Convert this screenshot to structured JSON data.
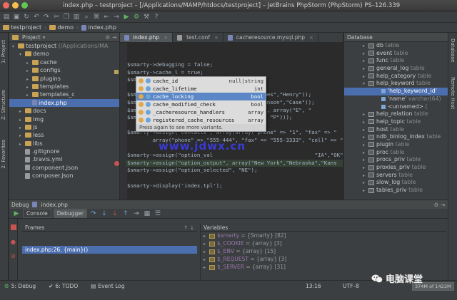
{
  "window": {
    "title": "index.php – testproject – [/Applications/MAMP/htdocs/testproject] – JetBrains PhpStorm (PhpStorm) PS–126.339"
  },
  "breadcrumb": [
    "testproject",
    "demo",
    "index.php"
  ],
  "left_strip": [
    "1: Project",
    "Z: Structure",
    "2: Favorites"
  ],
  "right_strip": [
    "Database",
    "Remote Host"
  ],
  "project": {
    "header": "Project",
    "tree": [
      {
        "label": "testproject",
        "suffix": " (/Applications/MA",
        "indent": 0,
        "kind": "folder",
        "open": true
      },
      {
        "label": "demo",
        "indent": 1,
        "kind": "folder",
        "open": true
      },
      {
        "label": "cache",
        "indent": 2,
        "kind": "folder"
      },
      {
        "label": "configs",
        "indent": 2,
        "kind": "folder"
      },
      {
        "label": "plugins",
        "indent": 2,
        "kind": "folder"
      },
      {
        "label": "templates",
        "indent": 2,
        "kind": "folder"
      },
      {
        "label": "templates_c",
        "indent": 2,
        "kind": "folder"
      },
      {
        "label": "index.php",
        "indent": 2,
        "kind": "php",
        "selected": true
      },
      {
        "label": "docs",
        "indent": 1,
        "kind": "folder"
      },
      {
        "label": "img",
        "indent": 1,
        "kind": "folder"
      },
      {
        "label": "js",
        "indent": 1,
        "kind": "folder"
      },
      {
        "label": "less",
        "indent": 1,
        "kind": "folder"
      },
      {
        "label": "libs",
        "indent": 1,
        "kind": "folder"
      },
      {
        "label": ".gitignore",
        "indent": 1,
        "kind": "file"
      },
      {
        "label": ".travis.yml",
        "indent": 1,
        "kind": "file"
      },
      {
        "label": "component.json",
        "indent": 1,
        "kind": "file"
      },
      {
        "label": "composer.json",
        "indent": 1,
        "kind": "file"
      }
    ]
  },
  "editor": {
    "tabs": [
      {
        "label": "index.php",
        "active": true
      },
      {
        "label": "test.conf",
        "active": false
      },
      {
        "label": "cacheresource.mysql.php",
        "active": false
      }
    ],
    "lines": [
      {
        "t": "$smarty->debugging = false;"
      },
      {
        "t": "$smarty->cache_l = true;"
      },
      {
        "t": "$sma"
      },
      {
        "t": ""
      },
      {
        "t": "$sma                                    \"James\",\"Henry\"));"
      },
      {
        "t": "$sma                                    \"Johnson\",\"Case\"));"
      },
      {
        "t": "$sma                                    \"D\"), array(\"E\", \""
      },
      {
        "t": "$sma                                    \"G\", \"P\")));"
      },
      {
        "t": ""
      },
      {
        "t": "$smarty->assign(\"contacts\", array(array(\"phone\" => \"1\", \"fax\" => \""
      },
      {
        "t": "        array(\"phone\" => \"555-444\", \"fax\" => \"555-3333\", \"cell\" => \""
      },
      {
        "t": ""
      },
      {
        "t": "$smarty->assign(\"option_val                                \"IA\",\"OK\",\"T"
      },
      {
        "t": "$smarty->assign(\"option_output\", array(\"New York\",\"Nebraska\",\"Kans",
        "hl": true
      },
      {
        "t": "$smarty->assign(\"option_selected\", \"NE\");"
      },
      {
        "t": ""
      },
      {
        "t": "$smarty->display('index.tpl');"
      }
    ],
    "completion": {
      "items": [
        {
          "name": "cache_id",
          "type": "null|string",
          "selected": false
        },
        {
          "name": "cache_lifetime",
          "type": "int",
          "selected": false
        },
        {
          "name": "cache_locking",
          "type": "bool",
          "selected": true
        },
        {
          "name": "cache_modified_check",
          "type": "bool",
          "selected": false
        },
        {
          "name": "_cacheresource_handlers",
          "type": "array",
          "selected": false
        },
        {
          "name": "registered_cache_resources",
          "type": "array",
          "selected": false
        }
      ],
      "hint": "Press again to see more variants."
    },
    "watermark": "www.jdwx.cn"
  },
  "database": {
    "items": [
      {
        "name": "db",
        "t": " table",
        "kind": "table"
      },
      {
        "name": "event",
        "t": " table",
        "kind": "table"
      },
      {
        "name": "func",
        "t": " table",
        "kind": "table"
      },
      {
        "name": "general_log",
        "t": " table",
        "kind": "table"
      },
      {
        "name": "help_category",
        "t": " table",
        "kind": "table"
      },
      {
        "name": "help_keyword",
        "t": " table",
        "kind": "table",
        "open": true
      },
      {
        "name": "'help_keyword_id'",
        "t": "",
        "kind": "col",
        "selected": true
      },
      {
        "name": "'name'",
        "t": " varchar(64)",
        "kind": "col"
      },
      {
        "name": "<unnamed>",
        "t": " (",
        "kind": "col"
      },
      {
        "name": "help_relation",
        "t": " table",
        "kind": "table"
      },
      {
        "name": "help_topic",
        "t": " table",
        "kind": "table"
      },
      {
        "name": "host",
        "t": " table",
        "kind": "table"
      },
      {
        "name": "ndb_binlog_index",
        "t": " table",
        "kind": "table"
      },
      {
        "name": "plugin",
        "t": " table",
        "kind": "table"
      },
      {
        "name": "proc",
        "t": " table",
        "kind": "table"
      },
      {
        "name": "procs_priv",
        "t": " table",
        "kind": "table"
      },
      {
        "name": "proxies_priv",
        "t": " table",
        "kind": "table"
      },
      {
        "name": "servers",
        "t": " table",
        "kind": "table"
      },
      {
        "name": "slow_log",
        "t": " table",
        "kind": "table"
      },
      {
        "name": "tables_priv",
        "t": " table",
        "kind": "table"
      }
    ]
  },
  "debug": {
    "header": "Debug",
    "file": "index.php",
    "tabs": [
      "Console",
      "Debugger"
    ],
    "frames_title": "Frames",
    "frame": "index.php:26, {main}()",
    "variables_title": "Variables",
    "variables": [
      {
        "name": "$smarty",
        "value": " = {Smarty} [82]"
      },
      {
        "name": "$_COOKIE",
        "value": " = {array} [3]"
      },
      {
        "name": "$_ENV",
        "value": " = {array} [15]"
      },
      {
        "name": "$_REQUEST",
        "value": " = {array} [3]"
      },
      {
        "name": "$_SERVER",
        "value": " = {array} [31]"
      }
    ]
  },
  "status": {
    "tabs": [
      "5: Debug",
      "6: TODO",
      "Event Log"
    ],
    "position": "13:16",
    "encoding": "UTF–8",
    "memory": "374M of 1422M"
  },
  "brand": {
    "text": "电脑课堂"
  },
  "colors": {
    "accent": "#4b6eaf",
    "background": "#2b2b2b",
    "panel": "#3c3f41"
  }
}
